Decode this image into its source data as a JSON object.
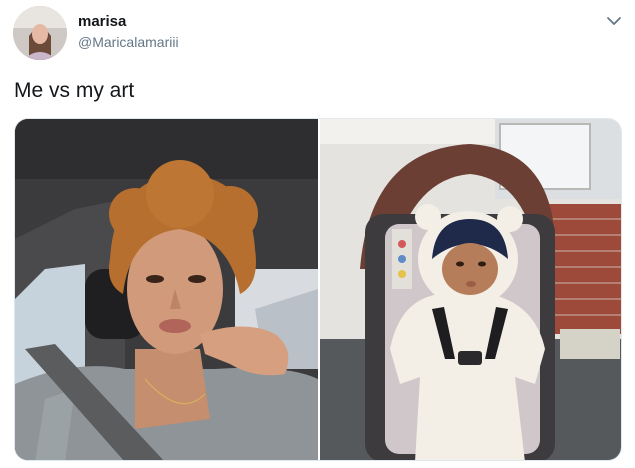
{
  "tweet": {
    "display_name": "marisa",
    "handle": "@Maricalamariii",
    "text": "Me vs my art",
    "menu_icon": "chevron-down-icon",
    "photos": [
      {
        "subject": "selfie-in-car"
      },
      {
        "subject": "baby-in-stroller"
      }
    ]
  }
}
